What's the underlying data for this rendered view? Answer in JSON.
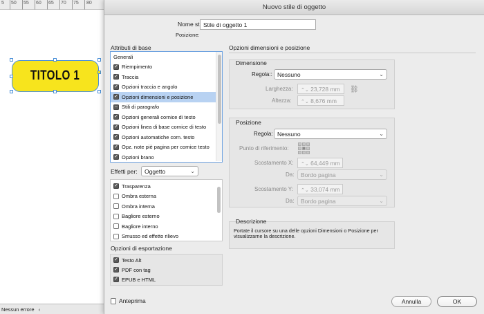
{
  "canvas": {
    "ruler_ticks": [
      "5",
      "50",
      "55",
      "60",
      "65",
      "70",
      "75",
      "80"
    ],
    "title_box_text": "TITOLO 1",
    "status_text": "Nessun errore",
    "status_chevron": "‹"
  },
  "dialog": {
    "title": "Nuovo stile di oggetto",
    "style_name_label": "Nome stile:",
    "style_name_value": "Stile di oggetto 1",
    "position_label": "Posizione:",
    "base_attributes_heading": "Attributi di base",
    "base_attributes": [
      {
        "label": "Generali",
        "checkbox": "none",
        "selected": false
      },
      {
        "label": "Riempimento",
        "checkbox": "checked",
        "selected": false
      },
      {
        "label": "Traccia",
        "checkbox": "checked",
        "selected": false
      },
      {
        "label": "Opzioni traccia e angolo",
        "checkbox": "checked",
        "selected": false
      },
      {
        "label": "Opzioni dimensioni e posizione",
        "checkbox": "checked",
        "selected": true
      },
      {
        "label": "Stili di paragrafo",
        "checkbox": "indeterminate",
        "selected": false
      },
      {
        "label": "Opzioni generali cornice di testo",
        "checkbox": "checked",
        "selected": false
      },
      {
        "label": "Opzioni linea di base cornice di testo",
        "checkbox": "checked",
        "selected": false
      },
      {
        "label": "Opzioni automatiche corn. testo",
        "checkbox": "checked",
        "selected": false
      },
      {
        "label": "Opz. note piè pagina per cornice testo",
        "checkbox": "checked",
        "selected": false
      },
      {
        "label": "Opzioni brano",
        "checkbox": "checked",
        "selected": false
      }
    ],
    "effects_for_label": "Effetti per:",
    "effects_for_value": "Oggetto",
    "effects": [
      {
        "label": "Trasparenza",
        "checked": true
      },
      {
        "label": "Ombra esterna",
        "checked": false
      },
      {
        "label": "Ombra interna",
        "checked": false
      },
      {
        "label": "Bagliore esterno",
        "checked": false
      },
      {
        "label": "Bagliore interno",
        "checked": false
      },
      {
        "label": "Smusso ed effetto rilievo",
        "checked": false
      }
    ],
    "export_heading": "Opzioni di esportazione",
    "export_options": [
      {
        "label": "Testo Alt",
        "checked": true
      },
      {
        "label": "PDF con tag",
        "checked": true
      },
      {
        "label": "EPUB e HTML",
        "checked": true
      }
    ],
    "panel_heading": "Opzioni dimensioni e posizione",
    "size": {
      "heading": "Dimensione",
      "adjust_label": "Regola::",
      "adjust_value": "Nessuno",
      "width_label": "Larghezza:",
      "width_value": "23,728 mm",
      "height_label": "Altezza:",
      "height_value": "8,676 mm"
    },
    "position": {
      "heading": "Posizione",
      "adjust_label": "Regola:",
      "adjust_value": "Nessuno",
      "reference_label": "Punto di riferimento:",
      "offset_x_label": "Scostamento X:",
      "offset_x_value": "64,449 mm",
      "from_x_label": "Da:",
      "from_x_value": "Bordo pagina",
      "offset_y_label": "Scostamento Y:",
      "offset_y_value": "33,074 mm",
      "from_y_label": "Da:",
      "from_y_value": "Bordo pagina"
    },
    "description": {
      "heading": "Descrizione",
      "text_line1": "Portate il cursore su una delle opzioni Dimensioni o Posizione per",
      "text_line2": "visualizzarne la descrizione."
    },
    "preview_label": "Anteprima",
    "cancel_label": "Annulla",
    "ok_label": "OK"
  }
}
